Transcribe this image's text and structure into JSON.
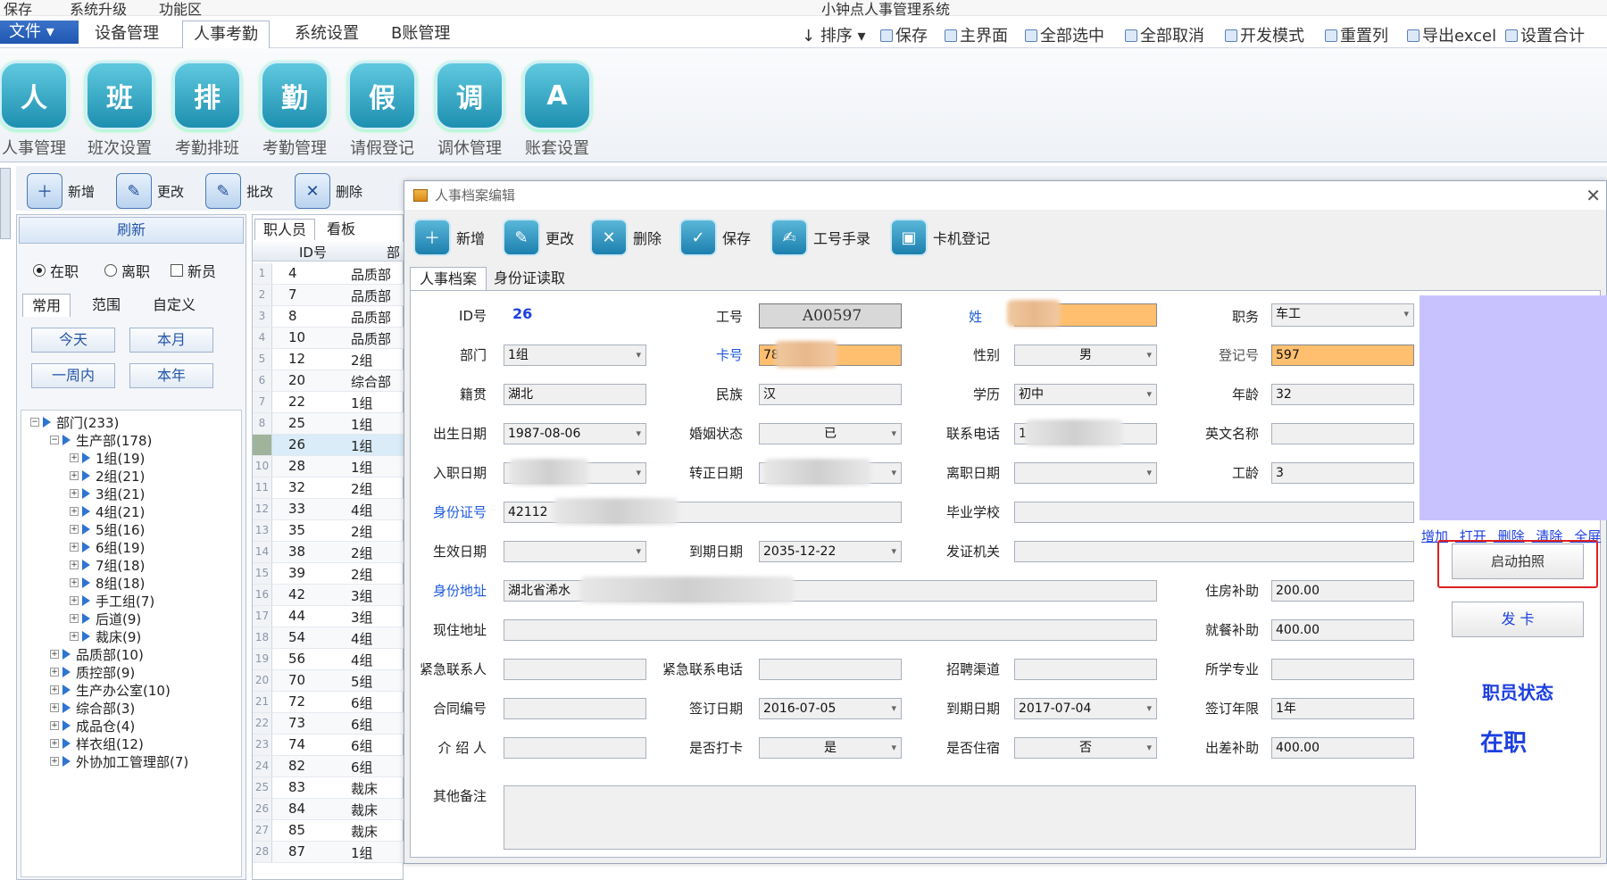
{
  "window": {
    "quick_items": [
      "保存",
      "系统升级",
      "功能区"
    ],
    "title": "小钟点人事管理系统"
  },
  "menu": {
    "file_label": "文件",
    "tabs": [
      "设备管理",
      "人事考勤",
      "系统设置",
      "B账管理"
    ],
    "actions": [
      "排序",
      "保存",
      "主界面",
      "全部选中",
      "全部取消",
      "开发模式",
      "重置列",
      "导出excel",
      "设置合计"
    ]
  },
  "ribbon": {
    "buttons": [
      {
        "label": "人事管理",
        "glyph": "人"
      },
      {
        "label": "班次设置",
        "glyph": "班"
      },
      {
        "label": "考勤排班",
        "glyph": "排"
      },
      {
        "label": "考勤管理",
        "glyph": "勤"
      },
      {
        "label": "请假登记",
        "glyph": "假"
      },
      {
        "label": "调休管理",
        "glyph": "调"
      },
      {
        "label": "账套设置",
        "glyph": "A"
      }
    ]
  },
  "toolbar": {
    "new_label": "新增",
    "edit_label": "更改",
    "batch_label": "批改",
    "delete_label": "删除"
  },
  "left_panel": {
    "refresh_label": "刷新",
    "radio_on_job": "在职",
    "radio_left": "离职",
    "check_new": "新员",
    "tabs": [
      "常用",
      "范围",
      "自定义"
    ],
    "quick": [
      "今天",
      "本月",
      "一周内",
      "本年"
    ],
    "tree": [
      {
        "label": "部门(233)",
        "level": 0,
        "expanded": true
      },
      {
        "label": "生产部(178)",
        "level": 1,
        "expanded": true
      },
      {
        "label": "1组(19)",
        "level": 2
      },
      {
        "label": "2组(21)",
        "level": 2
      },
      {
        "label": "3组(21)",
        "level": 2
      },
      {
        "label": "4组(21)",
        "level": 2
      },
      {
        "label": "5组(16)",
        "level": 2
      },
      {
        "label": "6组(19)",
        "level": 2
      },
      {
        "label": "7组(18)",
        "level": 2
      },
      {
        "label": "8组(18)",
        "level": 2
      },
      {
        "label": "手工组(7)",
        "level": 2
      },
      {
        "label": "后道(9)",
        "level": 2
      },
      {
        "label": "裁床(9)",
        "level": 2
      },
      {
        "label": "品质部(10)",
        "level": 1
      },
      {
        "label": "质控部(9)",
        "level": 1
      },
      {
        "label": "生产办公室(10)",
        "level": 1
      },
      {
        "label": "综合部(3)",
        "level": 1
      },
      {
        "label": "成品仓(4)",
        "level": 1
      },
      {
        "label": "样衣组(12)",
        "level": 1
      },
      {
        "label": "外协加工管理部(7)",
        "level": 1
      }
    ]
  },
  "grid": {
    "tabs": [
      "职人员",
      "看板"
    ],
    "col_id": "ID号",
    "col_dept": "部",
    "rows": [
      {
        "n": "1",
        "id": "4",
        "dept": "品质部"
      },
      {
        "n": "2",
        "id": "7",
        "dept": "品质部"
      },
      {
        "n": "3",
        "id": "8",
        "dept": "品质部"
      },
      {
        "n": "4",
        "id": "10",
        "dept": "品质部"
      },
      {
        "n": "5",
        "id": "12",
        "dept": "2组"
      },
      {
        "n": "6",
        "id": "20",
        "dept": "综合部"
      },
      {
        "n": "7",
        "id": "22",
        "dept": "1组"
      },
      {
        "n": "8",
        "id": "25",
        "dept": "1组"
      },
      {
        "n": "",
        "id": "26",
        "dept": "1组"
      },
      {
        "n": "10",
        "id": "28",
        "dept": "1组"
      },
      {
        "n": "11",
        "id": "32",
        "dept": "2组"
      },
      {
        "n": "12",
        "id": "33",
        "dept": "4组"
      },
      {
        "n": "13",
        "id": "35",
        "dept": "2组"
      },
      {
        "n": "14",
        "id": "38",
        "dept": "2组"
      },
      {
        "n": "15",
        "id": "39",
        "dept": "2组"
      },
      {
        "n": "16",
        "id": "42",
        "dept": "3组"
      },
      {
        "n": "17",
        "id": "44",
        "dept": "3组"
      },
      {
        "n": "18",
        "id": "54",
        "dept": "4组"
      },
      {
        "n": "19",
        "id": "56",
        "dept": "4组"
      },
      {
        "n": "20",
        "id": "70",
        "dept": "5组"
      },
      {
        "n": "21",
        "id": "72",
        "dept": "6组"
      },
      {
        "n": "22",
        "id": "73",
        "dept": "6组"
      },
      {
        "n": "23",
        "id": "74",
        "dept": "6组"
      },
      {
        "n": "24",
        "id": "82",
        "dept": "6组"
      },
      {
        "n": "25",
        "id": "83",
        "dept": "裁床"
      },
      {
        "n": "26",
        "id": "84",
        "dept": "裁床"
      },
      {
        "n": "27",
        "id": "85",
        "dept": "裁床"
      },
      {
        "n": "28",
        "id": "87",
        "dept": "1组"
      }
    ]
  },
  "dialog": {
    "title": "人事档案编辑",
    "toolbar": [
      "新增",
      "更改",
      "删除",
      "保存",
      "工号手录",
      "卡机登记"
    ],
    "tabs": [
      "人事档案",
      "身份证读取"
    ],
    "labels": {
      "id": "ID号",
      "job_no": "工号",
      "name": "姓",
      "position": "职务",
      "dept": "部门",
      "card_no": "卡号",
      "gender": "性别",
      "reg_no": "登记号",
      "native": "籍贯",
      "ethnic": "民族",
      "education": "学历",
      "age": "年龄",
      "birth": "出生日期",
      "marital": "婚姻状态",
      "phone": "联系电话",
      "english_name": "英文名称",
      "entry": "入职日期",
      "regular": "转正日期",
      "leave": "离职日期",
      "seniority": "工龄",
      "idcard": "身份证号",
      "school": "毕业学校",
      "effective": "生效日期",
      "expire": "到期日期",
      "issuer": "发证机关",
      "id_address": "身份地址",
      "housing": "住房补助",
      "cur_address": "现住地址",
      "meal": "就餐补助",
      "emergency": "紧急联系人",
      "emergency_phone": "紧急联系电话",
      "channel": "招聘渠道",
      "major": "所学专业",
      "contract_no": "合同编号",
      "sign_date": "签订日期",
      "due_date": "到期日期",
      "years": "签订年限",
      "referrer": "介 绍 人",
      "punch": "是否打卡",
      "dorm": "是否住宿",
      "travel": "出差补助",
      "remark": "其他备注"
    },
    "values": {
      "id": "26",
      "job_no": "A00597",
      "position": "车工",
      "dept": "1组",
      "card_no": "78",
      "gender": "男",
      "reg_no": "597",
      "native": "湖北",
      "ethnic": "汉",
      "education": "初中",
      "age": "32",
      "birth": "1987-08-06",
      "marital": "已",
      "phone": "1",
      "english_name": "",
      "seniority": "3",
      "idcard": "42112",
      "expire": "2035-12-22",
      "id_address": "湖北省浠水",
      "housing": "200.00",
      "meal": "400.00",
      "sign_date": "2016-07-05",
      "due_date": "2017-07-04",
      "years": "1年",
      "punch": "是",
      "dorm": "否",
      "travel": "400.00"
    },
    "photo_links": [
      "增加",
      "打开",
      "删除",
      "清除",
      "全屏"
    ],
    "camera_btn": "启动拍照",
    "card_btn": "发 卡",
    "status_label": "职员状态",
    "status_value": "在职"
  },
  "colors": {
    "accent": "#1d3fe0",
    "highlight_field": "#ffbf6e",
    "photo_bg": "#c8c3ff",
    "callout": "#e02020"
  }
}
